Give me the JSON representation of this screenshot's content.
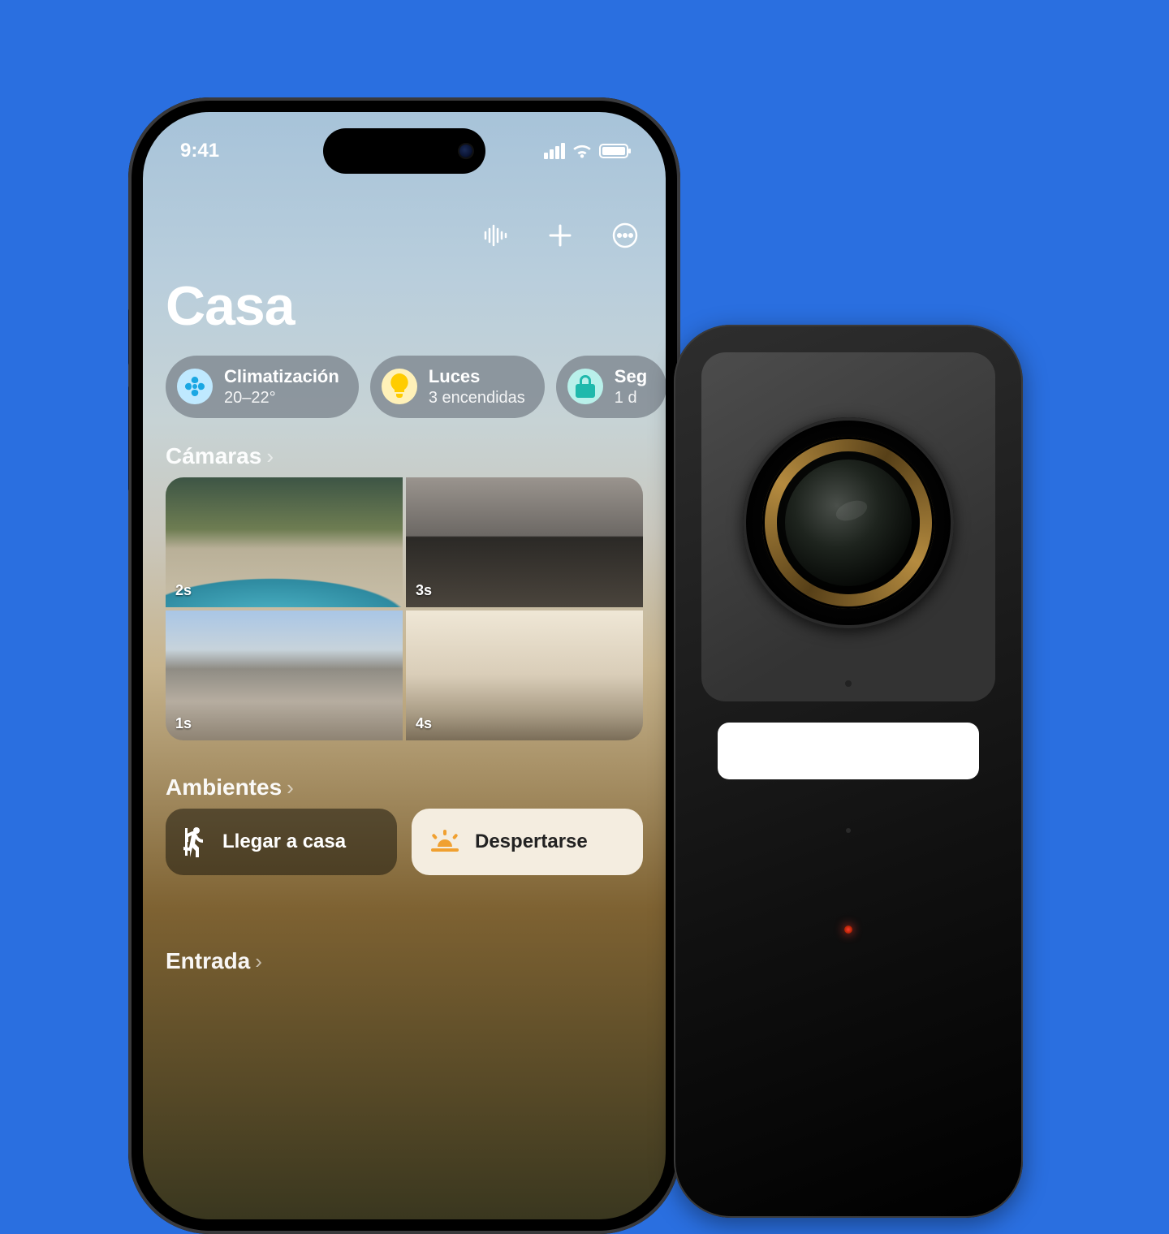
{
  "status": {
    "time": "9:41"
  },
  "home": {
    "title": "Casa",
    "categories": [
      {
        "id": "climate",
        "icon": "fan",
        "icon_color": "#5ec8fa",
        "title": "Climatización",
        "subtitle": "20–22°"
      },
      {
        "id": "lights",
        "icon": "bulb",
        "icon_color": "#ffd60a",
        "title": "Luces",
        "subtitle": "3 encendidas"
      },
      {
        "id": "security",
        "icon": "lock",
        "icon_color": "#30d5c8",
        "title": "Seg",
        "subtitle": "1 d"
      }
    ],
    "sections": {
      "cameras": "Cámaras",
      "scenes": "Ambientes",
      "entry": "Entrada"
    },
    "cameras": [
      {
        "id": "pool",
        "ts": "2s"
      },
      {
        "id": "garage",
        "ts": "3s"
      },
      {
        "id": "front",
        "ts": "1s"
      },
      {
        "id": "living",
        "ts": "4s"
      }
    ],
    "scenes": [
      {
        "id": "arrive",
        "label": "Llegar a casa",
        "variant": "dark",
        "icon": "person-walk"
      },
      {
        "id": "wake",
        "label": "Despertarse",
        "variant": "light",
        "icon": "sunrise"
      }
    ]
  }
}
